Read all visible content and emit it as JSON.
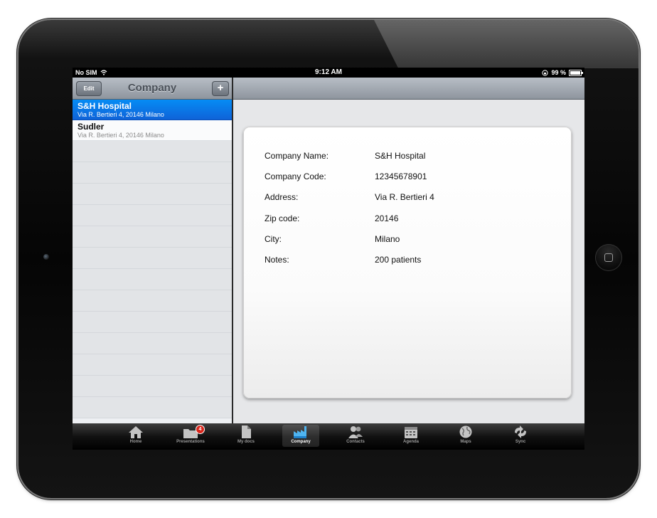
{
  "status_bar": {
    "carrier": "No SIM",
    "time": "9:12 AM",
    "battery": "99 %",
    "battery_level": 0.99
  },
  "master": {
    "title": "Company",
    "edit_label": "Edit",
    "add_label": "+",
    "companies": [
      {
        "name": "S&H Hospital",
        "address": "Via R. Bertieri 4, 20146 Milano",
        "selected": true
      },
      {
        "name": "Sudler",
        "address": "Via R. Bertieri 4, 20146 Milano",
        "selected": false
      }
    ]
  },
  "detail": {
    "fields": [
      {
        "label": "Company Name:",
        "value": "S&H Hospital"
      },
      {
        "label": "Company Code:",
        "value": "12345678901"
      },
      {
        "label": "Address:",
        "value": "Via R. Bertieri 4"
      },
      {
        "label": "Zip code:",
        "value": "20146"
      },
      {
        "label": "City:",
        "value": "Milano"
      },
      {
        "label": "Notes:",
        "value": "200 patients"
      }
    ]
  },
  "tabbar": {
    "tabs": [
      {
        "label": "Home",
        "icon": "home-icon"
      },
      {
        "label": "Presentations",
        "icon": "folder-icon",
        "badge": "4"
      },
      {
        "label": "My docs",
        "icon": "document-icon"
      },
      {
        "label": "Company",
        "icon": "factory-icon",
        "active": true
      },
      {
        "label": "Contacts",
        "icon": "contacts-icon"
      },
      {
        "label": "Agenda",
        "icon": "calendar-icon"
      },
      {
        "label": "Maps",
        "icon": "globe-icon"
      },
      {
        "label": "Sync",
        "icon": "sync-icon"
      }
    ]
  },
  "colors": {
    "selection": "#0f63d8",
    "badge": "#d9261c",
    "navbar": "#9aa1aa"
  }
}
